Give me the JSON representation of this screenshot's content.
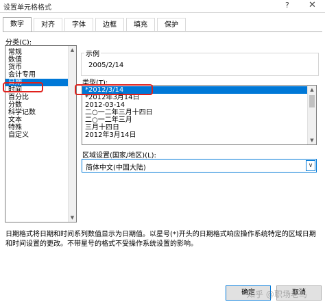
{
  "window": {
    "title": "设置单元格格式",
    "help_glyph": "?",
    "close_glyph": "✕"
  },
  "tabs": [
    {
      "label": "数字",
      "active": true
    },
    {
      "label": "对齐"
    },
    {
      "label": "字体"
    },
    {
      "label": "边框"
    },
    {
      "label": "填充"
    },
    {
      "label": "保护"
    }
  ],
  "category": {
    "label": "分类(C):",
    "items": [
      "常规",
      "数值",
      "货币",
      "会计专用",
      "日期",
      "时间",
      "百分比",
      "分数",
      "科学记数",
      "文本",
      "特殊",
      "自定义"
    ],
    "selected_index": 4
  },
  "sample": {
    "label": "示例",
    "value": "2005/2/14"
  },
  "type": {
    "label": "类型(T):",
    "items": [
      "*2012/3/14",
      "*2012年3月14日",
      "2012-03-14",
      "二○一二年三月十四日",
      "二○一二年三月",
      "三月十四日",
      "2012年3月14日"
    ],
    "selected_index": 0
  },
  "locale": {
    "label": "区域设置(国家/地区)(L):",
    "value": "简体中文(中国大陆)"
  },
  "description": "日期格式将日期和时间系列数值显示为日期值。以星号(*)开头的日期格式响应操作系统特定的区域日期和时间设置的更改。不带星号的格式不受操作系统设置的影响。",
  "buttons": {
    "ok": "确定",
    "cancel": "取消"
  },
  "watermark": "知乎 @职场老鸟",
  "colors": {
    "selection": "#0078d7",
    "highlight_box": "#e0201b"
  }
}
